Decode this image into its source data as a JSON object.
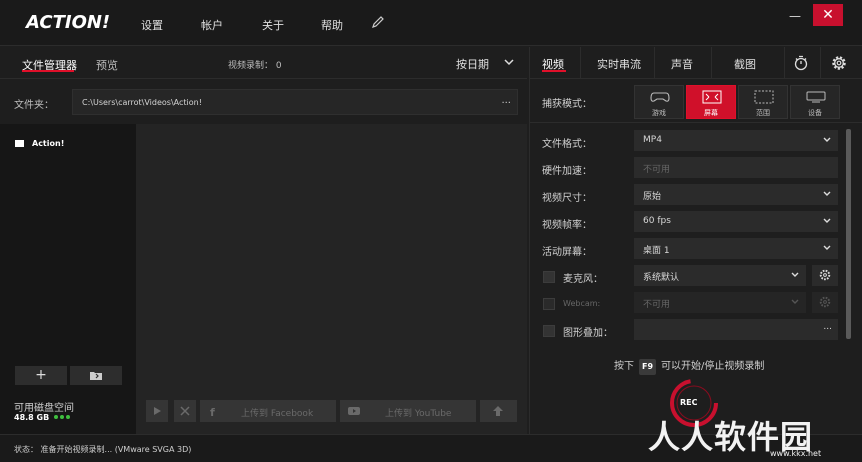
{
  "app": {
    "logo_text": "ACTION!",
    "menu": [
      "设置",
      "帐户",
      "关于",
      "帮助"
    ],
    "window_controls": {
      "minimize": "—",
      "close": "✕"
    }
  },
  "left": {
    "tabs": [
      "文件管理器",
      "预览"
    ],
    "recording_count": "视频录制： 0",
    "sort_label": "按日期",
    "folder_label": "文件夹：",
    "folder_path": "C:\\Users\\carrot\\Videos\\Action!",
    "folder_more": "...",
    "tree_item": "Action!",
    "add_label": "+",
    "disk_label": "可用磁盘空间",
    "disk_value": "48.8 GB",
    "upload_facebook": "上传到 Facebook",
    "upload_youtube": "上传到 YouTube"
  },
  "right": {
    "tabs": [
      "视频",
      "实时串流",
      "声音",
      "截图"
    ],
    "capture_label": "捕获模式：",
    "modes": [
      "游戏",
      "屏幕",
      "范围",
      "设备"
    ],
    "active_mode": "屏幕",
    "settings": {
      "format_label": "文件格式：",
      "format_value": "MP4",
      "hw_label": "硬件加速：",
      "hw_value": "不可用",
      "size_label": "视频尺寸：",
      "size_value": "原始",
      "fps_label": "视频帧率：",
      "fps_value": "60 fps",
      "screen_label": "活动屏幕：",
      "screen_value": "桌面 1",
      "mic_label": "麦克风：",
      "mic_value": "系统默认",
      "webcam_label": "Webcam:",
      "webcam_value": "不可用",
      "overlay_label": "图形叠加：",
      "overlay_more": "..."
    },
    "hint_prefix": "按下",
    "hint_key": "F9",
    "hint_suffix": "可以开始/停止视频录制",
    "rec_label": "REC"
  },
  "status": {
    "text": "状态：   准备开始视频录制...  (VMware SVGA 3D)"
  },
  "watermark": {
    "text": "人人软件园",
    "url": "www.kkx.net"
  },
  "colors": {
    "accent": "#d0102a",
    "ok": "#3fbf3f"
  }
}
